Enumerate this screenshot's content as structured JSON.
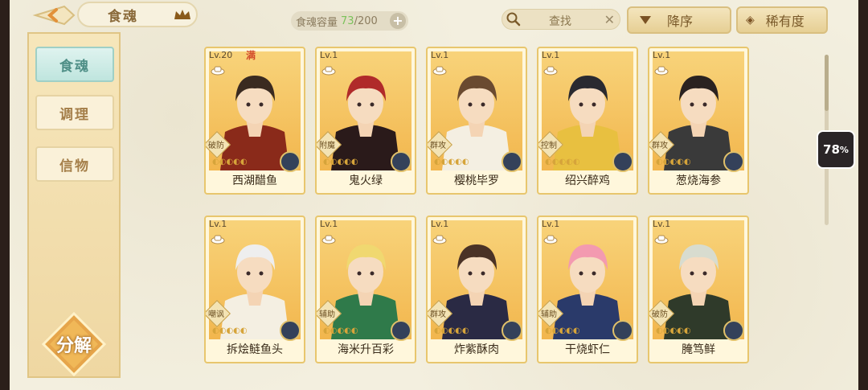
{
  "header": {
    "title": "食魂",
    "capacity_label": "食魂容量",
    "capacity_current": "73",
    "capacity_total": "/200",
    "plus": "+",
    "search_placeholder": "查找",
    "search_clear": "✕",
    "sort_desc": "降序",
    "sort_rarity": "稀有度",
    "rarity_icon": "◈"
  },
  "sidebar": {
    "items": [
      {
        "label": "食魂",
        "active": true
      },
      {
        "label": "调理",
        "active": false
      },
      {
        "label": "信物",
        "active": false
      }
    ],
    "decompose": "分解"
  },
  "overlay": {
    "percent": "78",
    "unit": "%"
  },
  "cards": [
    {
      "level": "Lv.20",
      "max": "满",
      "role": "破防",
      "name": "西湖醋鱼",
      "hair": "#3a2a20",
      "coat": "#8a2a1a"
    },
    {
      "level": "Lv.1",
      "max": "",
      "role": "附魔",
      "name": "鬼火绿",
      "hair": "#b02a2a",
      "coat": "#2a1a1a"
    },
    {
      "level": "Lv.1",
      "max": "",
      "role": "群攻",
      "name": "樱桃毕罗",
      "hair": "#6a4a30",
      "coat": "#f4efe2"
    },
    {
      "level": "Lv.1",
      "max": "",
      "role": "控制",
      "name": "绍兴醉鸡",
      "hair": "#2a2a30",
      "coat": "#e8c040"
    },
    {
      "level": "Lv.1",
      "max": "",
      "role": "群攻",
      "name": "葱烧海参",
      "hair": "#2a2220",
      "coat": "#3a3a3a"
    },
    {
      "level": "Lv.1",
      "max": "",
      "role": "嘲讽",
      "name": "拆烩鲢鱼头",
      "hair": "#eeeeee",
      "coat": "#f4efe2"
    },
    {
      "level": "Lv.1",
      "max": "",
      "role": "辅助",
      "name": "海米升百彩",
      "hair": "#f0d870",
      "coat": "#2f7a4a"
    },
    {
      "level": "Lv.1",
      "max": "",
      "role": "群攻",
      "name": "炸紫酥肉",
      "hair": "#4a3226",
      "coat": "#2a2a44"
    },
    {
      "level": "Lv.1",
      "max": "",
      "role": "辅助",
      "name": "干烧虾仁",
      "hair": "#f39ab0",
      "coat": "#2a3a6a"
    },
    {
      "level": "Lv.1",
      "max": "",
      "role": "破防",
      "name": "腌笃鲜",
      "hair": "#d8dccf",
      "coat": "#2f3a2a"
    }
  ]
}
